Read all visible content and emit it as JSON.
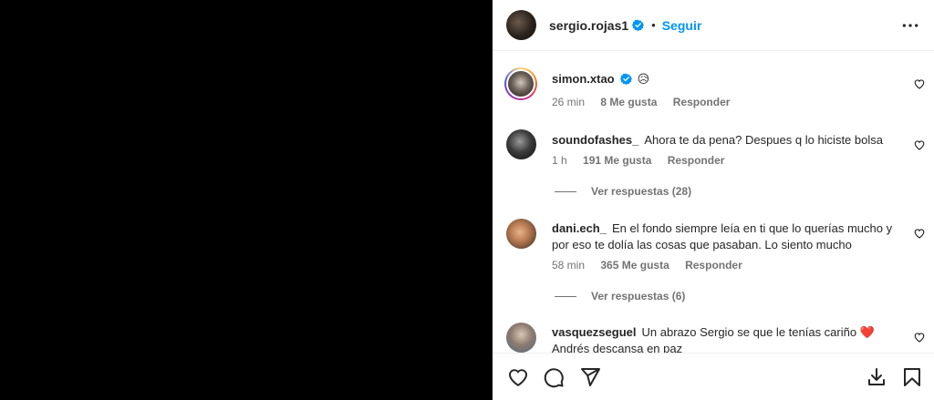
{
  "post": {
    "author": "sergio.rojas1",
    "follow_label": "Seguir",
    "separator": "•"
  },
  "comments": [
    {
      "user": "simon.xtao",
      "text": "😥",
      "time": "26 min",
      "likes": "8 Me gusta",
      "reply_label": "Responder",
      "verified": true
    },
    {
      "user": "soundofashes_",
      "text": "Ahora te da pena? Despues q lo hiciste bolsa",
      "time": "1 h",
      "likes": "191 Me gusta",
      "reply_label": "Responder",
      "view_replies": "Ver respuestas (28)"
    },
    {
      "user": "dani.ech_",
      "text": "En el fondo siempre leía en ti que lo querías mucho y por eso te dolía las cosas que pasaban. Lo siento mucho",
      "time": "58 min",
      "likes": "365 Me gusta",
      "reply_label": "Responder",
      "view_replies": "Ver respuestas (6)"
    },
    {
      "user": "vasquezseguel",
      "text": "Un abrazo Sergio se que le tenías cariño ❤️ Andrés descansa en paz"
    }
  ],
  "icons": {
    "more": "more-options-icon",
    "like": "heart-icon",
    "comment": "comment-icon",
    "share": "paper-plane-icon",
    "download": "download-icon",
    "save": "bookmark-icon",
    "verified": "verified-badge-icon"
  },
  "colors": {
    "accent": "#0095f6",
    "verified": "#0095f6",
    "heart_red": "#e0245e",
    "muted": "#737373",
    "text": "#262626"
  }
}
